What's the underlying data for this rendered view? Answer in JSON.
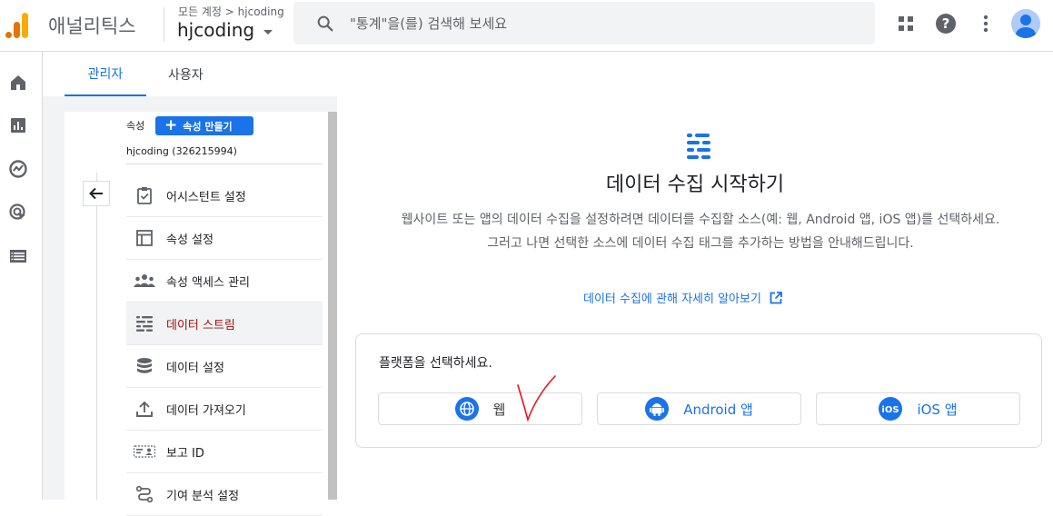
{
  "header": {
    "app_name": "애널리틱스",
    "account_crumb": "모든 계정 > hjcoding",
    "account_name": "hjcoding",
    "search_placeholder": "\"통계\"을(를) 검색해 보세요"
  },
  "tabs": [
    {
      "label": "관리자",
      "active": true
    },
    {
      "label": "사용자",
      "active": false
    }
  ],
  "property": {
    "label": "속성",
    "create_button": "속성 만들기",
    "name": "hjcoding (326215994)"
  },
  "menu": [
    {
      "label": "어시스턴트 설정",
      "icon": "clipboard-check-icon"
    },
    {
      "label": "속성 설정",
      "icon": "layout-icon"
    },
    {
      "label": "속성 액세스 관리",
      "icon": "people-icon"
    },
    {
      "label": "데이터 스트림",
      "icon": "streams-icon",
      "active": true
    },
    {
      "label": "데이터 설정",
      "icon": "database-icon"
    },
    {
      "label": "데이터 가져오기",
      "icon": "upload-icon"
    },
    {
      "label": "보고 ID",
      "icon": "id-card-icon"
    },
    {
      "label": "기여 분석 설정",
      "icon": "route-icon"
    }
  ],
  "main": {
    "title": "데이터 수집 시작하기",
    "description": "웹사이트 또는 앱의 데이터 수집을 설정하려면 데이터를 수집할 소스(예: 웹, Android 앱, iOS 앱)를 선택하세요. 그러고 나면 선택한 소스에 데이터 수집 태그를 추가하는 방법을 안내해드립니다.",
    "learn_link": "데이터 수집에 관해 자세히 알아보기",
    "platform_title": "플랫폼을 선택하세요.",
    "platforms": [
      {
        "label": "웹",
        "icon": "globe-icon"
      },
      {
        "label": "Android 앱",
        "icon": "android-icon"
      },
      {
        "label": "iOS 앱",
        "icon": "ios-icon"
      }
    ]
  },
  "colors": {
    "accent": "#1a73e8",
    "active_text": "#a50e0e",
    "background_gray": "#f1f3f4"
  }
}
